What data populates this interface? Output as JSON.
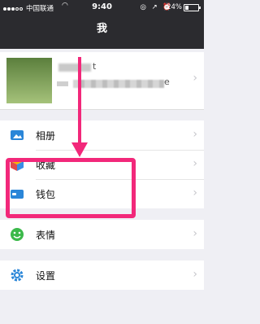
{
  "status_bar": {
    "carrier": "中国联通",
    "time": "9:40",
    "status_icons": "◎ ↗ ⏰",
    "battery_text": "24%",
    "battery_level": 0.24
  },
  "nav": {
    "title": "我"
  },
  "profile": {
    "name_partial": "t",
    "wechat_id_partial": "e"
  },
  "menu": {
    "album": "相册",
    "favorites": "收藏",
    "wallet": "钱包",
    "stickers": "表情",
    "settings": "设置"
  },
  "colors": {
    "nav_bg": "#2b2b2f",
    "annotation": "#f2287a",
    "page_bg": "#efeff4"
  },
  "icons": [
    "album-icon",
    "favorites-icon",
    "wallet-icon",
    "stickers-icon",
    "settings-icon",
    "chevron-right-icon"
  ]
}
